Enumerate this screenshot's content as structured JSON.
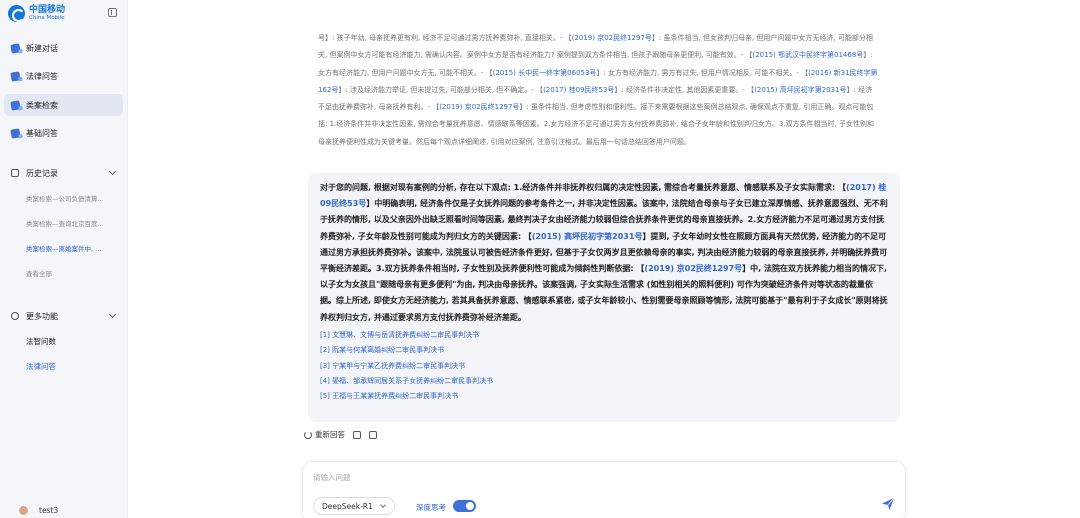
{
  "logo": {
    "cn": "中国移动",
    "en": "China Mobile"
  },
  "nav": [
    {
      "label": "新建对话"
    },
    {
      "label": "法律问答"
    },
    {
      "label": "类案检索"
    },
    {
      "label": "基础问答"
    }
  ],
  "history": {
    "title": "历史记录",
    "items": [
      "类案检索—公司负债清算...",
      "类案检索—查询北京百度...",
      "类案检索—离婚案件中, ...",
      "查看全部"
    ]
  },
  "more": {
    "title": "更多功能",
    "items": [
      "法智问数",
      "法律问答"
    ]
  },
  "user": {
    "name": "test3"
  },
  "ref_text": {
    "s1": "号】: 孩子年幼, 母亲抚养更有利, 经济不足可通过男方抚养费弥补, 直接相关。- 【",
    "l1": "(2019) 京02民终1297号",
    "s2": "】: 虽条件相当, 但女孩判归母亲, 但用户问题中女方无经济, 可能部分相关, 但案例中女方可能有经济能力, 需确认内容。案例中女方是否有经济能力? 案例提到双方条件相当, 但孩子跟随母亲更便利, 可能有效。- 【",
    "l2": "(2015) 鄂武汉中民终字第01468号",
    "s3": "】: 女方有经济能力, 但用户问题中女方无, 可能不相关。- 【",
    "l3": "(2015) 长中民一终字第06053号",
    "s4": "】: 女方有经济能力, 男方有过失, 但用户情况相反, 可能不相关。- 【",
    "l4": "(2016) 新31民终字第162号",
    "s5": "】: 涉及经济能力举证, 但未提过失, 可能部分相关, 但不确定。- 【",
    "l5": "(2017) 桂09民终53号",
    "s6": "】: 经济条件非决定性, 其他因素更重要。- 【",
    "l6": "(2015) 高坪民初字第2031号",
    "s7": "】: 经济不足由抚养费弥补, 母亲抚养有利。- 【",
    "l7": "(2019) 京02民终1297号",
    "s8": "】: 虽条件相当, 但考虑性别和便利性。接下来需要根据这些案例总结观点, 确保观点不重复, 引用正确。观点可能包括: 1.经济条件并非决定性因素, 需综合考量抚养意愿、情感联系等因素。2.女方经济不足可通过男方支付抚养费弥补, 结合子女年龄和性别判归女方。3.双方条件相当时, 子女性别和母亲抚养便利性成为关键考量。然后每个观点详细阐述, 引用对应案例, 注意引注格式。最后用一句话总结回答用户问题。"
  },
  "answer": {
    "p1": "对于您的问题, 根据对现有案例的分析, 存在以下观点: 1.经济条件并非抚养权归属的决定性因素, 需综合考量抚养意愿、情感联系及子女实际需求: 【",
    "l1": "(2017) 桂09民终53号",
    "p2": "】中明确表明, 经济条件仅是子女抚养问题的参考条件之一, 并非决定性因素。该案中, 法院结合母亲与子女已建立深厚情感、抚养意愿强烈、无不利于抚养的情形, 以及父亲因外出缺乏照看时间等因素, 最终判决子女由经济能力较弱但综合抚养条件更优的母亲直接抚养。2.女方经济能力不足可通过男方支付抚养费弥补, 子女年龄及性别可能成为判归女方的关键因素: 【",
    "l2": "(2015) 高坪民初字第2031号",
    "p3": "】提到, 子女年幼时女性在照顾方面具有天然优势, 经济能力的不足可通过男方承担抚养费弥补。该案中, 法院虽认可被告经济条件更好, 但基于子女仅两岁且更依赖母亲的事实, 判决由经济能力较弱的母亲直接抚养, 并明确抚养费可平衡经济差距。3.双方抚养条件相当时, 子女性别及抚养便利性可能成为倾斜性判断依据: 【",
    "l3": "(2019) 京02民终1297号",
    "p4": "】中, 法院在双方抚养能力相当的情况下, 以子女为女孩且\"跟随母亲有更多便利\"为由, 判决由母亲抚养。该案强调, 子女实际生活需求 (如性别相关的照料便利) 可作为突破经济条件对等状态的裁量依据。综上所述, 即使女方无经济能力, 若其具备抚养意愿、情感联系紧密, 或子女年龄较小、性别需要母亲照顾等情形, 法院可能基于\"最有利于子女成长\"原则将抚养权判归女方, 并通过要求男方支付抚养费弥补经济差距。",
    "citations": [
      "[1] 文慧琳、文博与岳清抚养费纠纷二审民事判决书",
      "[2] 阮某与何某离婚纠纷二审民事判决书",
      "[3] 宁某甲与宁某乙抚养费纠纷二审民事判决书",
      "[4] 晏福、邹承辉同居关系子女抚养纠纷二审民事判决书",
      "[5] 王福与王某某抚养费纠纷二审民事判决书"
    ]
  },
  "actions": {
    "regenerate": "重新回答"
  },
  "input": {
    "placeholder": "请输入问题",
    "model": "DeepSeek-R1",
    "deep_think": "深度思考"
  },
  "colors": {
    "accent": "#3f6fd8",
    "link": "#2f66d0"
  }
}
